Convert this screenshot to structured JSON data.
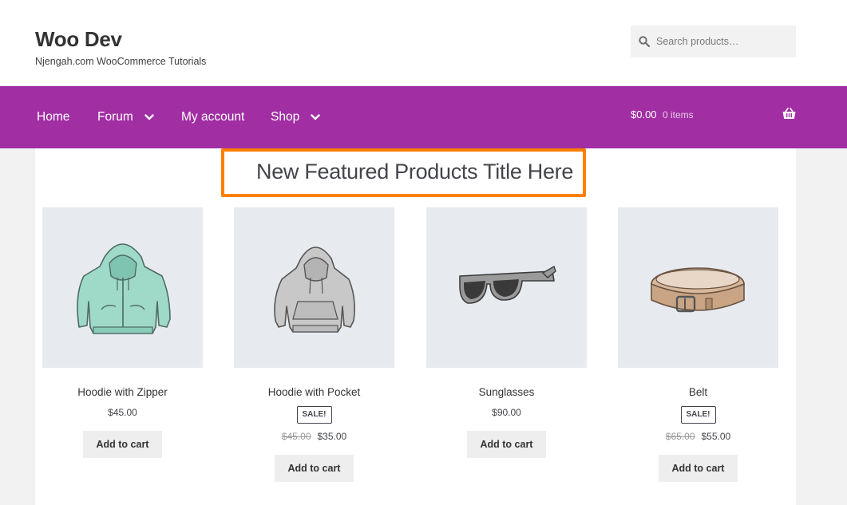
{
  "site": {
    "title": "Woo Dev",
    "tagline": "Njengah.com WooCommerce Tutorials"
  },
  "search": {
    "placeholder": "Search products…"
  },
  "nav": {
    "items": [
      {
        "label": "Home",
        "has_dropdown": false
      },
      {
        "label": "Forum",
        "has_dropdown": true
      },
      {
        "label": "My account",
        "has_dropdown": false
      },
      {
        "label": "Shop",
        "has_dropdown": true
      }
    ]
  },
  "cart": {
    "amount": "$0.00",
    "count": "0 items",
    "icon": "basket-icon"
  },
  "featured": {
    "title": "New Featured Products Title Here"
  },
  "products": [
    {
      "name": "Hoodie with Zipper",
      "on_sale": false,
      "sale_label": "",
      "old_price": "",
      "price": "$45.00",
      "button": "Add to cart",
      "image": "hoodie-zipper-image"
    },
    {
      "name": "Hoodie with Pocket",
      "on_sale": true,
      "sale_label": "SALE!",
      "old_price": "$45.00",
      "price": "$35.00",
      "button": "Add to cart",
      "image": "hoodie-pocket-image"
    },
    {
      "name": "Sunglasses",
      "on_sale": false,
      "sale_label": "",
      "old_price": "",
      "price": "$90.00",
      "button": "Add to cart",
      "image": "sunglasses-image"
    },
    {
      "name": "Belt",
      "on_sale": true,
      "sale_label": "SALE!",
      "old_price": "$65.00",
      "price": "$55.00",
      "button": "Add to cart",
      "image": "belt-image"
    }
  ],
  "colors": {
    "nav_bg": "#a12fa3",
    "highlight_border": "#ff7f00",
    "thumb_bg": "#e7ebf0"
  }
}
